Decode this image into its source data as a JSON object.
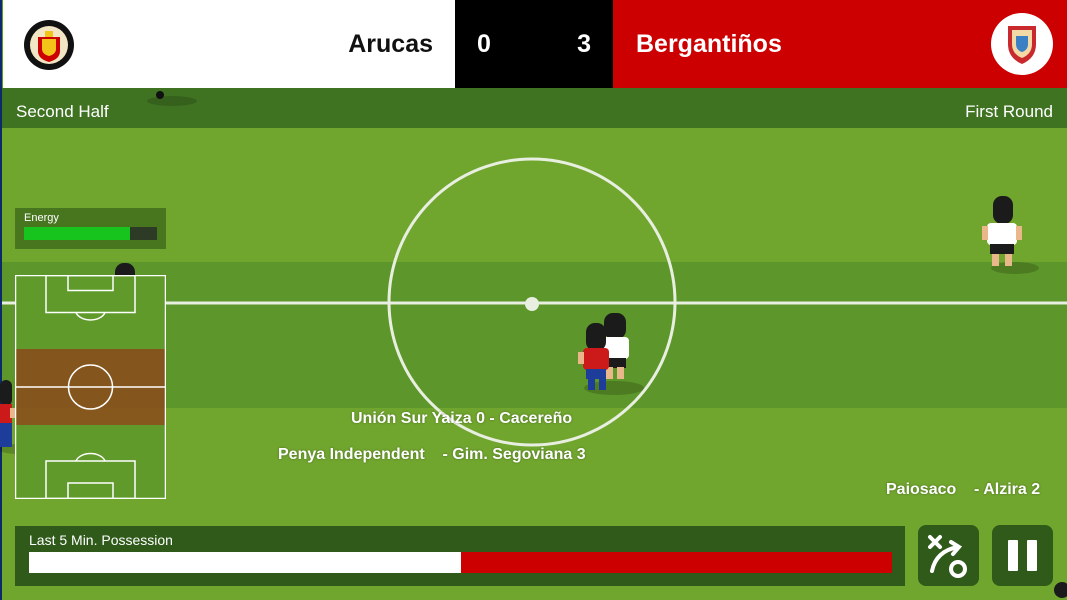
{
  "scoreboard": {
    "home_name": "Arucas",
    "away_name": "Bergantiños",
    "home_score": "0",
    "away_score": "3",
    "home_color": "#ffffff",
    "away_color": "#cc0000",
    "home_crest_icon": "arucas-cf-crest",
    "away_crest_icon": "bergantinos-fc-crest"
  },
  "info_bar": {
    "half": "Second Half",
    "round": "First Round"
  },
  "energy": {
    "label": "Energy",
    "level": 0.8,
    "color": "#17c41d"
  },
  "ticker": [
    "Unión Sur Yaiza 0 - Cacereño",
    "Penya Independent    - Gim. Segoviana 3",
    "Paiosaco    - Alzira 2"
  ],
  "possession": {
    "label": "Last 5 Min. Possession",
    "home_share": 0.5
  },
  "controls": {
    "tactics_icon": "tactics-substitution-icon",
    "pause_icon": "pause-icon"
  }
}
